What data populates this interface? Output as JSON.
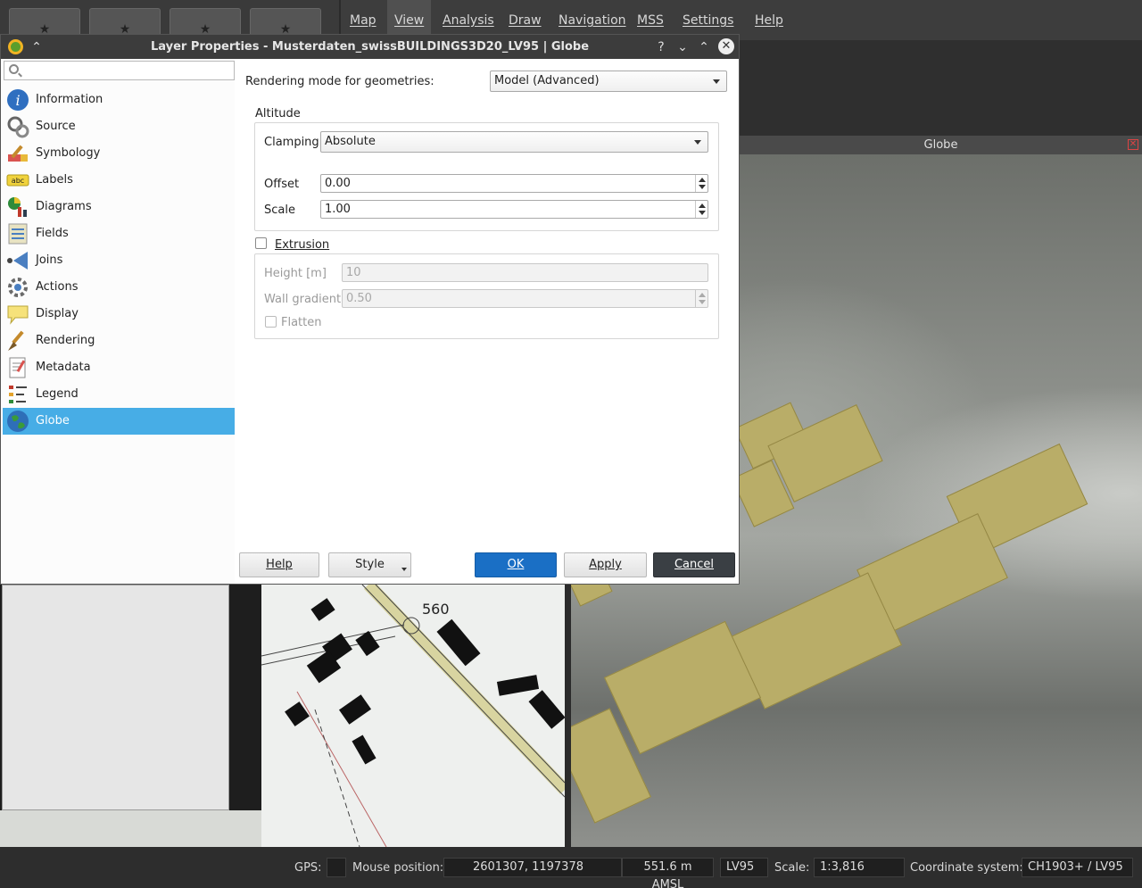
{
  "app": {
    "menu": [
      "Map",
      "View",
      "Analysis",
      "Draw",
      "Navigation",
      "MSS",
      "Settings",
      "Help"
    ],
    "active_menu": "View",
    "fav_star": "★"
  },
  "globe_panel": {
    "title": "Globe",
    "close_glyph": "✕"
  },
  "map": {
    "contour_label": "560"
  },
  "statusbar": {
    "gps_label": "GPS:",
    "mouse_label": "Mouse position:",
    "mouse_value": "2601307, 1197378",
    "altitude": "551.6 m AMSL",
    "crs_short": "LV95",
    "scale_label": "Scale:",
    "scale_value": "1:3,816",
    "crs_label": "Coordinate system:",
    "crs_value": "CH1903+ / LV95"
  },
  "dialog": {
    "title": "Layer Properties - Musterdaten_swissBUILDINGS3D20_LV95 | Globe",
    "help_glyph": "?",
    "minimize_glyph": "⌄",
    "maximize_glyph": "⌃",
    "close_glyph": "✕",
    "collapse_glyph": "⌃",
    "search": {
      "placeholder": "",
      "value": ""
    },
    "nav": [
      {
        "label": "Information",
        "icon": "info-icon"
      },
      {
        "label": "Source",
        "icon": "source-icon"
      },
      {
        "label": "Symbology",
        "icon": "symbology-icon"
      },
      {
        "label": "Labels",
        "icon": "labels-icon"
      },
      {
        "label": "Diagrams",
        "icon": "diagrams-icon"
      },
      {
        "label": "Fields",
        "icon": "fields-icon"
      },
      {
        "label": "Joins",
        "icon": "joins-icon"
      },
      {
        "label": "Actions",
        "icon": "actions-icon"
      },
      {
        "label": "Display",
        "icon": "display-icon"
      },
      {
        "label": "Rendering",
        "icon": "rendering-icon"
      },
      {
        "label": "Metadata",
        "icon": "metadata-icon"
      },
      {
        "label": "Legend",
        "icon": "legend-icon"
      },
      {
        "label": "Globe",
        "icon": "globe-icon"
      }
    ],
    "selected_nav": "Globe",
    "labels_icon_text": "abc",
    "content": {
      "rendering_mode_label": "Rendering mode for geometries:",
      "rendering_mode_value": "Model (Advanced)",
      "altitude_group": "Altitude",
      "clamping_label": "Clamping",
      "clamping_value": "Absolute",
      "offset_label": "Offset",
      "offset_value": "0.00",
      "scale_label": "Scale",
      "scale_value": "1.00",
      "extrusion_label": "Extrusion",
      "extrusion_checked": false,
      "height_label": "Height [m]",
      "height_value": "10",
      "wall_gradient_label": "Wall gradient",
      "wall_gradient_value": "0.50",
      "flatten_label": "Flatten",
      "flatten_checked": false
    },
    "buttons": {
      "help": "Help",
      "style": "Style",
      "ok": "OK",
      "apply": "Apply",
      "cancel": "Cancel"
    }
  }
}
